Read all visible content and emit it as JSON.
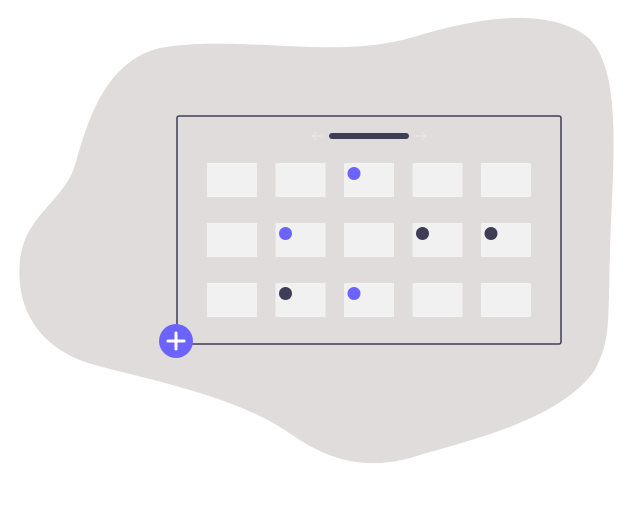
{
  "colors": {
    "blob": "#e1dcdc",
    "frame": "#3f3d56",
    "cell": "#f1f1f1",
    "accent": "#6c63ff",
    "dark_dot": "#3f3d56",
    "arrow": "#e6e6e6",
    "background": "#ffffff"
  },
  "header": {
    "prev_icon": "arrow-left-icon",
    "next_icon": "arrow-right-icon",
    "title_icon": "month-title-bar"
  },
  "calendar": {
    "rows": 3,
    "columns": 5,
    "events": [
      {
        "row": 0,
        "col": 2,
        "kind": "accent"
      },
      {
        "row": 1,
        "col": 1,
        "kind": "accent"
      },
      {
        "row": 1,
        "col": 3,
        "kind": "dark"
      },
      {
        "row": 1,
        "col": 4,
        "kind": "dark"
      },
      {
        "row": 2,
        "col": 1,
        "kind": "dark"
      },
      {
        "row": 2,
        "col": 2,
        "kind": "accent"
      }
    ]
  },
  "add_button": {
    "icon": "plus-icon"
  }
}
